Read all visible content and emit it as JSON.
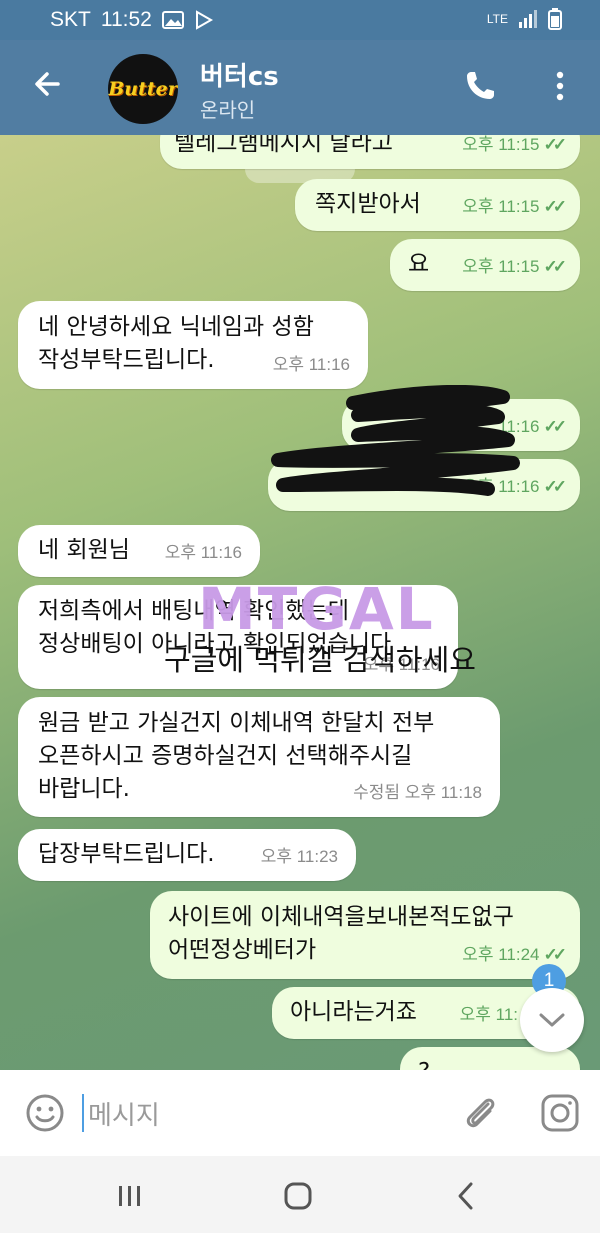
{
  "status_bar": {
    "carrier": "SKT",
    "time": "11:52",
    "network": "LTE"
  },
  "header": {
    "title": "버터cs",
    "subtitle": "온라인",
    "avatar_text": "Butter"
  },
  "messages": [
    {
      "dir": "out",
      "text": "텔레그램메시지 달라고",
      "time": "오후 11:15"
    },
    {
      "dir": "out",
      "text": "쪽지받아서",
      "time": "오후 11:15"
    },
    {
      "dir": "out",
      "text": "요",
      "time": "오후 11:15"
    },
    {
      "dir": "in",
      "text": "네 안녕하세요 닉네임과 성함\n작성부탁드립니다.",
      "time": "오후 11:16"
    },
    {
      "dir": "out",
      "text": "",
      "time": "11:16"
    },
    {
      "dir": "out",
      "text": "",
      "time": "오후 11:16"
    },
    {
      "dir": "in",
      "text": "네 회원님",
      "time": "오후 11:16"
    },
    {
      "dir": "in",
      "text": "저희측에서 배팅내역 확인했는데\n정상배팅이 아니라고 확인되었습니다",
      "time": "오후 11:16"
    },
    {
      "dir": "in",
      "text": "원금 받고 가실건지 이체내역 한달치 전부\n오픈하시고 증명하실건지 선택해주시길\n바랍니다.",
      "time": "수정됨 오후 11:18"
    },
    {
      "dir": "in",
      "text": "답장부탁드립니다.",
      "time": "오후 11:23"
    },
    {
      "dir": "out",
      "text": "사이트에 이체내역을보내본적도없구\n어떤정상베터가",
      "time": "오후 11:24"
    },
    {
      "dir": "out",
      "text": "아니라는거죠",
      "time": "오후 11:"
    },
    {
      "dir": "out",
      "text": "?",
      "time": ""
    }
  ],
  "watermark": {
    "logo": "MTGAL",
    "text": "구글에 먹튀갤 검색하세요"
  },
  "unread_badge": "1",
  "input": {
    "placeholder": "메시지"
  },
  "icons": {
    "back": "arrow-left-icon",
    "call": "phone-icon",
    "menu": "more-vertical-icon",
    "emoji": "emoji-icon",
    "attach": "paperclip-icon",
    "camera": "camera-icon",
    "scroll": "chevron-down-icon",
    "nav_recent": "recent-apps-icon",
    "nav_home": "home-icon",
    "nav_back": "nav-back-icon"
  }
}
